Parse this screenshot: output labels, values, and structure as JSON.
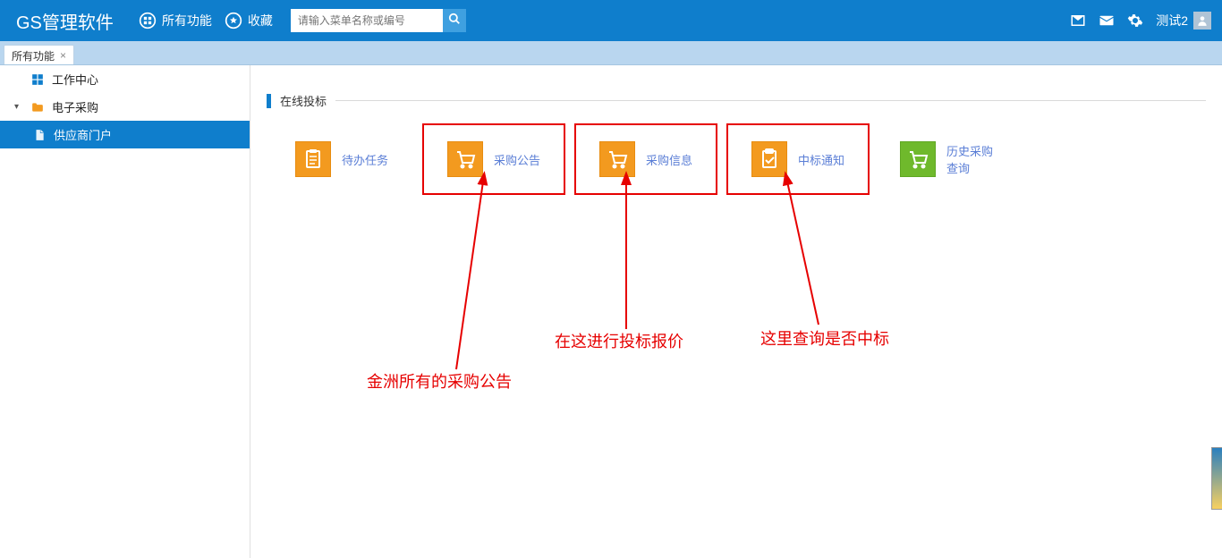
{
  "header": {
    "brand": "GS管理软件",
    "nav": {
      "all_functions": "所有功能",
      "favorites": "收藏"
    },
    "search_placeholder": "请输入菜单名称或编号",
    "user": "测试2"
  },
  "tabs": [
    {
      "label": "所有功能"
    }
  ],
  "sidebar": {
    "items": [
      {
        "label": "工作中心"
      },
      {
        "label": "电子采购"
      },
      {
        "label": "供应商门户"
      }
    ]
  },
  "section": {
    "title": "在线投标"
  },
  "tiles": [
    {
      "label": "待办任务"
    },
    {
      "label": "采购公告"
    },
    {
      "label": "采购信息"
    },
    {
      "label": "中标通知"
    },
    {
      "label": "历史采购查询"
    }
  ],
  "annotations": {
    "a1": "金洲所有的采购公告",
    "a2": "在这进行投标报价",
    "a3": "这里查询是否中标"
  }
}
